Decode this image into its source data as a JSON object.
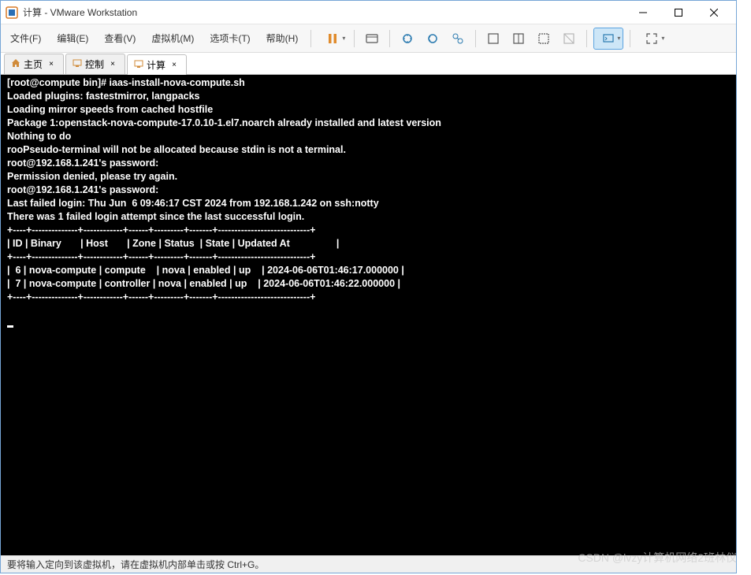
{
  "window": {
    "title": "计算 - VMware Workstation"
  },
  "menu": {
    "file": "文件(F)",
    "edit": "编辑(E)",
    "view": "查看(V)",
    "vm": "虚拟机(M)",
    "tabs": "选项卡(T)",
    "help": "帮助(H)"
  },
  "tabs": {
    "home": "主页",
    "control": "控制",
    "compute": "计算"
  },
  "term": {
    "l0": "[root@compute bin]# iaas-install-nova-compute.sh",
    "l1": "Loaded plugins: fastestmirror, langpacks",
    "l2": "Loading mirror speeds from cached hostfile",
    "l3": "Package 1:openstack-nova-compute-17.0.10-1.el7.noarch already installed and latest version",
    "l4": "Nothing to do",
    "l5": "rooPseudo-terminal will not be allocated because stdin is not a terminal.",
    "l6": "root@192.168.1.241's password: ",
    "l7": "Permission denied, please try again.",
    "l8": "root@192.168.1.241's password: ",
    "l9": "Last failed login: Thu Jun  6 09:46:17 CST 2024 from 192.168.1.242 on ssh:notty",
    "l10": "There was 1 failed login attempt since the last successful login.",
    "sep": "+----+--------------+------------+------+---------+-------+----------------------------+",
    "hdr": "| ID | Binary       | Host       | Zone | Status  | State | Updated At                 |",
    "r1": "|  6 | nova-compute | compute    | nova | enabled | up    | 2024-06-06T01:46:17.000000 |",
    "r2": "|  7 | nova-compute | controller | nova | enabled | up    | 2024-06-06T01:46:22.000000 |"
  },
  "status": {
    "hint": "要将输入定向到该虚拟机，请在虚拟机内部单击或按 Ctrl+G。"
  },
  "watermark": "CSDN @lvzy计算机网络2班林仪"
}
